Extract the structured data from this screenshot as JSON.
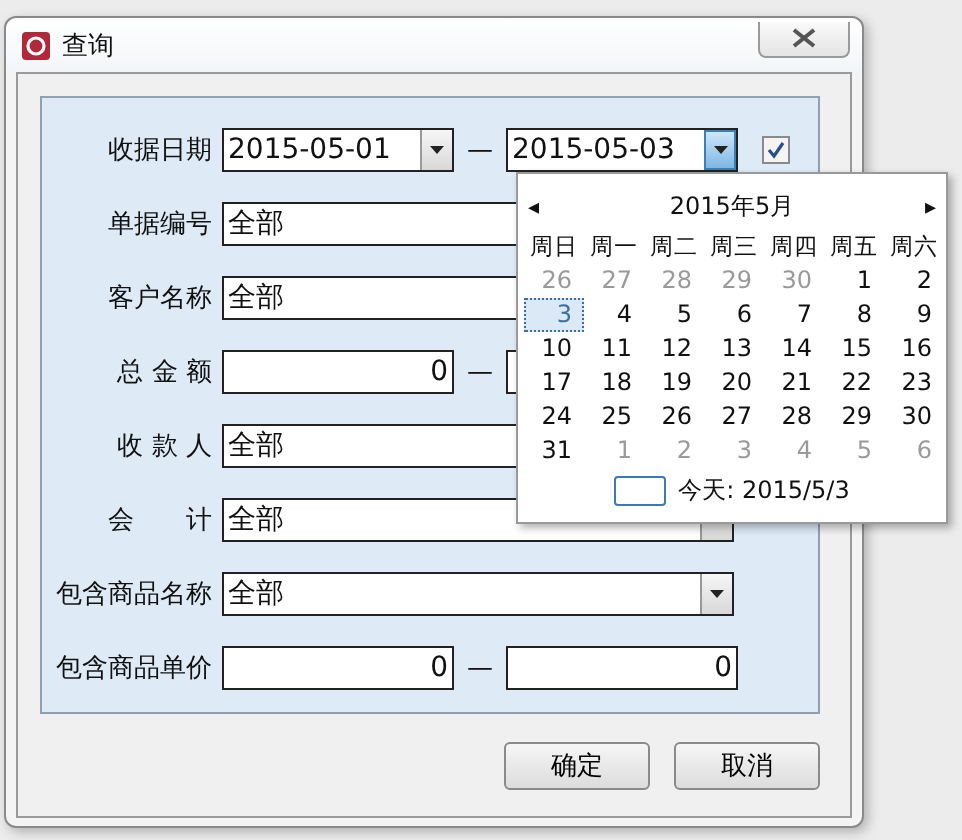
{
  "window": {
    "title": "查询"
  },
  "rows": [
    {
      "label": "收据日期",
      "kind": "date_range",
      "values": [
        "2015-05-01",
        "2015-05-03"
      ],
      "separator": "—",
      "checked": true
    },
    {
      "label": "单据编号",
      "kind": "text",
      "values": [
        "全部"
      ]
    },
    {
      "label": "客户名称",
      "kind": "text",
      "values": [
        "全部"
      ]
    },
    {
      "label": "总 金 额",
      "kind": "range",
      "values": [
        "0"
      ],
      "separator": "—"
    },
    {
      "label": "收 款 人",
      "kind": "text",
      "values": [
        "全部"
      ]
    },
    {
      "label": "会　　计",
      "kind": "combo",
      "values": [
        "全部"
      ]
    },
    {
      "label": "包含商品名称",
      "kind": "combo",
      "values": [
        "全部"
      ]
    },
    {
      "label": "包含商品单价",
      "kind": "range",
      "values": [
        "0",
        "0"
      ],
      "separator": "—"
    }
  ],
  "calendar": {
    "prev": "◂",
    "month": "2015年5月",
    "next": "▸",
    "weekdays": [
      "周日",
      "周一",
      "周二",
      "周三",
      "周四",
      "周五",
      "周六"
    ],
    "days": [
      {
        "day": "26",
        "muted": true,
        "selected": false
      },
      {
        "day": "27",
        "muted": true,
        "selected": false
      },
      {
        "day": "28",
        "muted": true,
        "selected": false
      },
      {
        "day": "29",
        "muted": true,
        "selected": false
      },
      {
        "day": "30",
        "muted": true,
        "selected": false
      },
      {
        "day": "1",
        "muted": false,
        "selected": false
      },
      {
        "day": "2",
        "muted": false,
        "selected": false
      },
      {
        "day": "3",
        "muted": false,
        "selected": true
      },
      {
        "day": "4",
        "muted": false,
        "selected": false
      },
      {
        "day": "5",
        "muted": false,
        "selected": false
      },
      {
        "day": "6",
        "muted": false,
        "selected": false
      },
      {
        "day": "7",
        "muted": false,
        "selected": false
      },
      {
        "day": "8",
        "muted": false,
        "selected": false
      },
      {
        "day": "9",
        "muted": false,
        "selected": false
      },
      {
        "day": "10",
        "muted": false,
        "selected": false
      },
      {
        "day": "11",
        "muted": false,
        "selected": false
      },
      {
        "day": "12",
        "muted": false,
        "selected": false
      },
      {
        "day": "13",
        "muted": false,
        "selected": false
      },
      {
        "day": "14",
        "muted": false,
        "selected": false
      },
      {
        "day": "15",
        "muted": false,
        "selected": false
      },
      {
        "day": "16",
        "muted": false,
        "selected": false
      },
      {
        "day": "17",
        "muted": false,
        "selected": false
      },
      {
        "day": "18",
        "muted": false,
        "selected": false
      },
      {
        "day": "19",
        "muted": false,
        "selected": false
      },
      {
        "day": "20",
        "muted": false,
        "selected": false
      },
      {
        "day": "21",
        "muted": false,
        "selected": false
      },
      {
        "day": "22",
        "muted": false,
        "selected": false
      },
      {
        "day": "23",
        "muted": false,
        "selected": false
      },
      {
        "day": "24",
        "muted": false,
        "selected": false
      },
      {
        "day": "25",
        "muted": false,
        "selected": false
      },
      {
        "day": "26",
        "muted": false,
        "selected": false
      },
      {
        "day": "27",
        "muted": false,
        "selected": false
      },
      {
        "day": "28",
        "muted": false,
        "selected": false
      },
      {
        "day": "29",
        "muted": false,
        "selected": false
      },
      {
        "day": "30",
        "muted": false,
        "selected": false
      },
      {
        "day": "31",
        "muted": false,
        "selected": false
      },
      {
        "day": "1",
        "muted": true,
        "selected": false
      },
      {
        "day": "2",
        "muted": true,
        "selected": false
      },
      {
        "day": "3",
        "muted": true,
        "selected": false
      },
      {
        "day": "4",
        "muted": true,
        "selected": false
      },
      {
        "day": "5",
        "muted": true,
        "selected": false
      },
      {
        "day": "6",
        "muted": true,
        "selected": false
      }
    ],
    "today": "今天: 2015/5/3"
  },
  "buttons": [
    "确定",
    "取消"
  ]
}
